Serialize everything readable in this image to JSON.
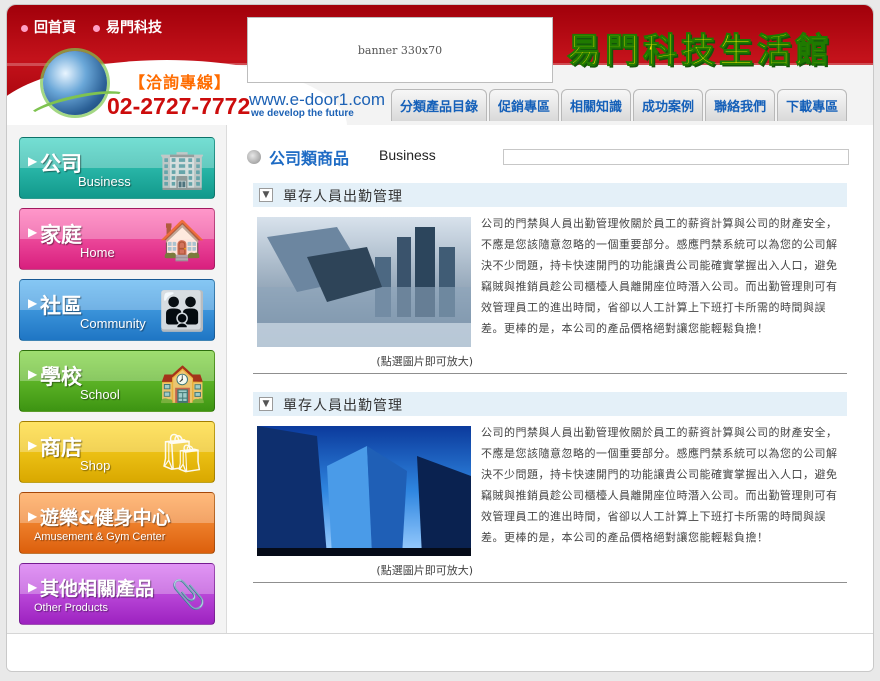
{
  "header": {
    "top_links": [
      "回首頁",
      "易門科技"
    ],
    "hotline_label": "【洽詢專線】",
    "hotline_number": "02-2727-7772",
    "banner_text": "banner 330x70",
    "site_title": "易門科技生活館",
    "domain": "www.e-door1.com",
    "slogan": "we develop the future",
    "nav": [
      "分類產品目錄",
      "促銷專區",
      "相關知識",
      "成功案例",
      "聯絡我們",
      "下載專區"
    ]
  },
  "sidebar": {
    "categories": [
      {
        "zh": "公司",
        "en": "Business",
        "color": "#1fb8a8",
        "icon": "building-icon"
      },
      {
        "zh": "家庭",
        "en": "Home",
        "color": "#e8398f",
        "icon": "house-icon"
      },
      {
        "zh": "社區",
        "en": "Community",
        "color": "#2a8fd8",
        "icon": "people-icon"
      },
      {
        "zh": "學校",
        "en": "School",
        "color": "#4fae1c",
        "icon": "school-icon"
      },
      {
        "zh": "商店",
        "en": "Shop",
        "color": "#e6b800",
        "icon": "shopping-bag-icon"
      },
      {
        "zh": "遊樂&健身中心",
        "en": "Amusement & Gym Center",
        "color": "#e8701a",
        "icon": "gym-icon"
      },
      {
        "zh": "其他相關產品",
        "en": "Other Products",
        "color": "#b23ad0",
        "icon": "paperclip-icon"
      }
    ]
  },
  "main": {
    "section_title": "公司類商品",
    "section_en": "Business",
    "items": [
      {
        "title": "單存人員出勤管理",
        "caption": "(點選圖片即可放大)",
        "description": "公司的門禁與人員出勤管理攸關於員工的薪資計算與公司的財產安全，不應是您該隨意忽略的一個重要部分。感應門禁系統可以為您的公司解決不少問題，持卡快速開門的功能讓貴公司能確實掌握出入人口，避免竊賊與推銷員趁公司櫃檯人員離開座位時潛入公司。而出勤管理則可有效管理員工的進出時間，省卻以人工計算上下班打卡所需的時間與誤差。更棒的是，本公司的產品價格絕對讓您能輕鬆負擔！"
      },
      {
        "title": "單存人員出勤管理",
        "caption": "(點選圖片即可放大)",
        "description": "公司的門禁與人員出勤管理攸關於員工的薪資計算與公司的財產安全，不應是您該隨意忽略的一個重要部分。感應門禁系統可以為您的公司解決不少問題，持卡快速開門的功能讓貴公司能確實掌握出入人口，避免竊賊與推銷員趁公司櫃檯人員離開座位時潛入公司。而出勤管理則可有效管理員工的進出時間，省卻以人工計算上下班打卡所需的時間與誤差。更棒的是，本公司的產品價格絕對讓您能輕鬆負擔！"
      }
    ]
  }
}
